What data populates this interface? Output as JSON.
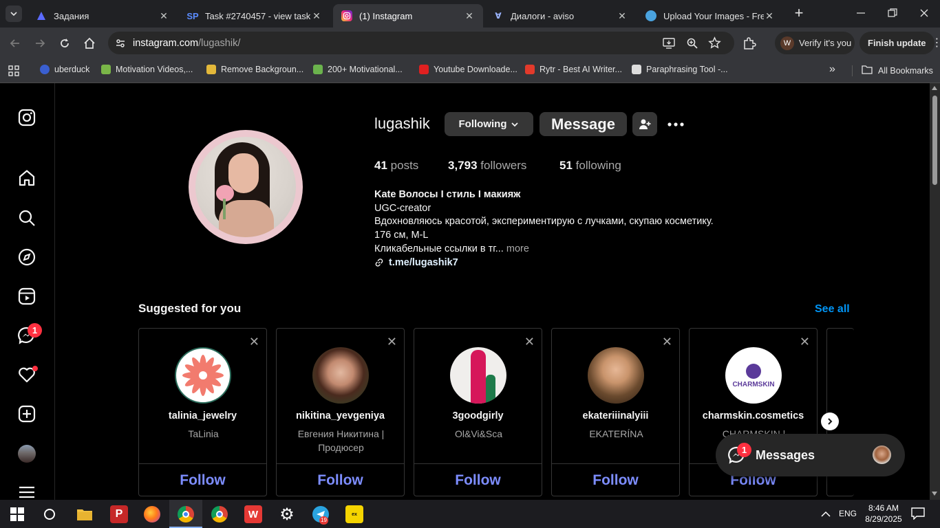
{
  "browser": {
    "tabs": [
      {
        "title": "Задания",
        "active": false
      },
      {
        "title": "Task #2740457 - view task",
        "active": false
      },
      {
        "title": "(1) Instagram",
        "active": true
      },
      {
        "title": "Диалоги - aviso",
        "active": false
      },
      {
        "title": "Upload Your Images - Free I",
        "active": false
      }
    ],
    "url_host": "instagram.com",
    "url_path": "/lugashik/",
    "verify_label": "Verify it's you",
    "finish_update_label": "Finish update",
    "bookmarks": [
      {
        "label": "uberduck",
        "color": "#3a5fd0"
      },
      {
        "label": "Motivation Videos,...",
        "color": "#7ab648"
      },
      {
        "label": "Remove Backgroun...",
        "color": "#e3b83a"
      },
      {
        "label": "200+ Motivational...",
        "color": "#6bb34d"
      },
      {
        "label": "Youtube Downloade...",
        "color": "#e02020"
      },
      {
        "label": "Rytr - Best AI Writer...",
        "color": "#e23a2b"
      },
      {
        "label": "Paraphrasing Tool -...",
        "color": "#dddddd"
      }
    ],
    "all_bookmarks_label": "All Bookmarks"
  },
  "sidebar": {
    "messages_badge": "1"
  },
  "profile": {
    "username": "lugashik",
    "following_btn": "Following",
    "message_btn": "Message",
    "posts_count": "41",
    "posts_label": "posts",
    "followers_count": "3,793",
    "followers_label": "followers",
    "following_count": "51",
    "following_label": "following",
    "bio_name": "Kate Волосы I стиль I макияж",
    "bio_lines": [
      "UGC-creator",
      "Вдохновляюсь красотой, экспериментирую с лучками, скупаю косметику.",
      "176 см, M-L",
      "Кликабельные ссылки в тг..."
    ],
    "more_label": "more",
    "link": "t.me/lugashik7"
  },
  "suggested": {
    "title": "Suggested for you",
    "see_all": "See all",
    "follow_label": "Follow",
    "cards": [
      {
        "username": "talinia_jewelry",
        "fullname": "TaLinia"
      },
      {
        "username": "nikitina_yevgeniya",
        "fullname": "Евгения Никитина | Продюсер"
      },
      {
        "username": "3goodgirly",
        "fullname": "Ol&Vi&Sca"
      },
      {
        "username": "ekateriiinalyiii",
        "fullname": "EKATERÍNA"
      },
      {
        "username": "charmskin.cosmetics",
        "fullname": "CHARMSKIN |",
        "logo_text": "CHARMSKIN"
      }
    ]
  },
  "messages_widget": {
    "label": "Messages",
    "badge": "1"
  },
  "taskbar": {
    "lang": "ENG",
    "time": "8:46 AM",
    "date": "8/29/2025",
    "telegram_badge": "19"
  }
}
